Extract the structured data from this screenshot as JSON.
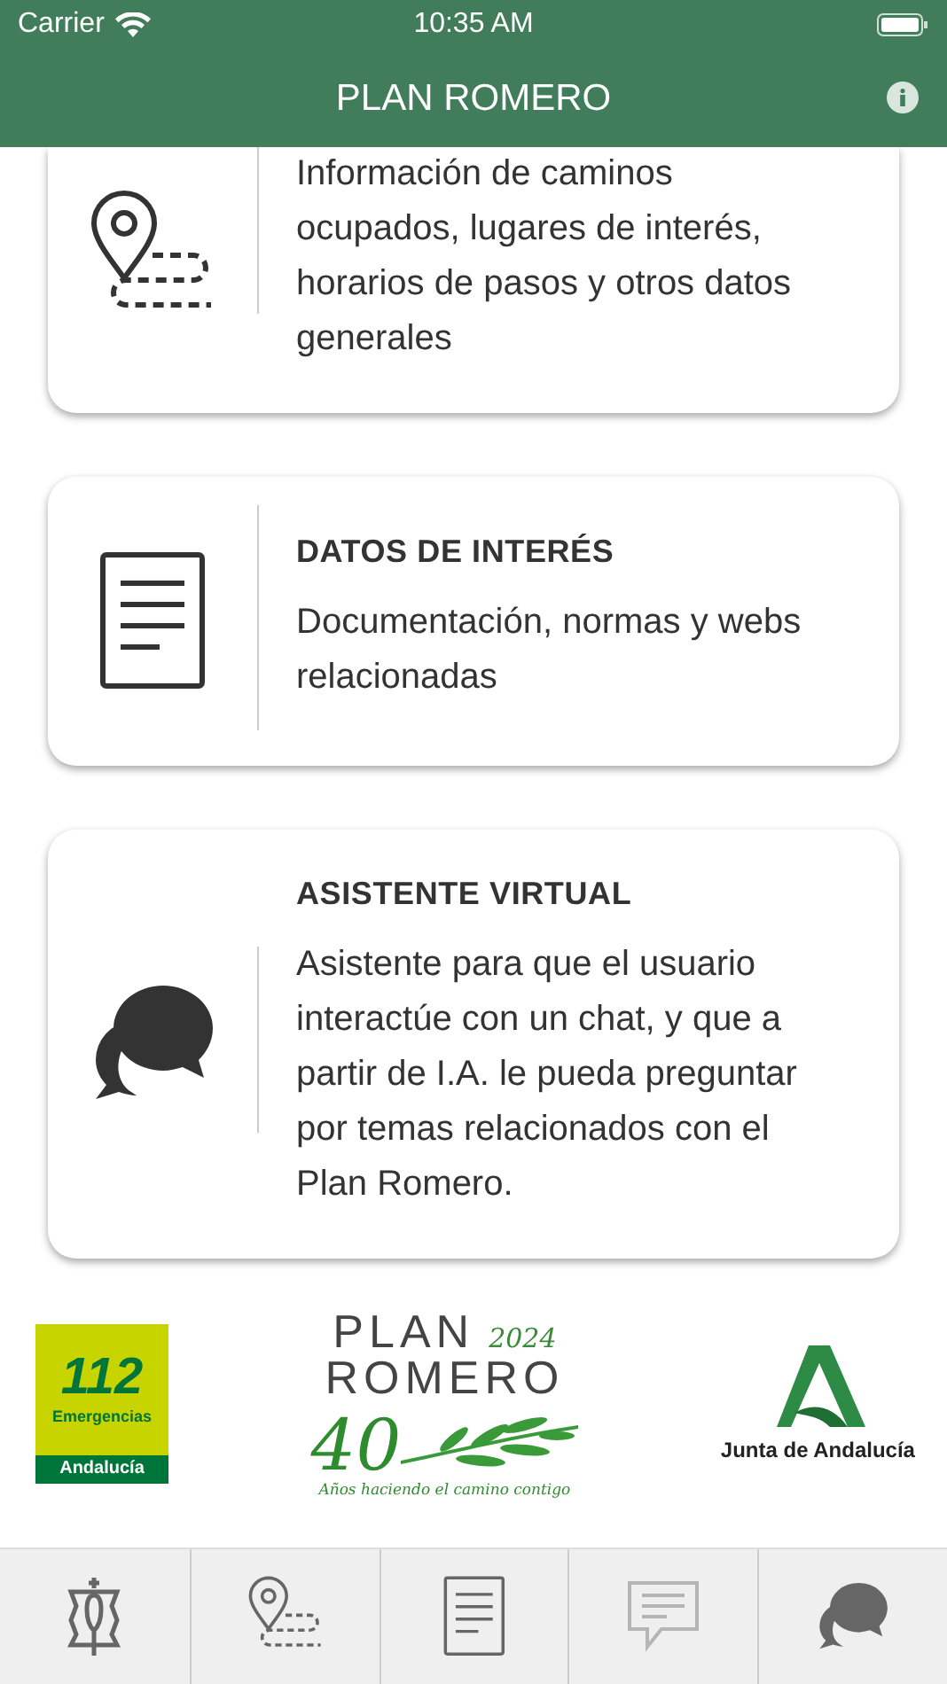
{
  "status_bar": {
    "carrier": "Carrier",
    "time": "10:35 AM"
  },
  "nav": {
    "title": "PLAN ROMERO"
  },
  "cards": [
    {
      "kind": "route",
      "description": "Información de caminos ocupados, lugares de interés, horarios de pasos y otros datos generales"
    },
    {
      "kind": "document",
      "title": "DATOS DE INTERÉS",
      "description": "Documentación, normas y webs relacionadas"
    },
    {
      "kind": "chat",
      "title": "ASISTENTE VIRTUAL",
      "description": "Asistente para que el usuario interactúe con un chat, y que a partir de I.A. le pueda preguntar por temas relacionados con el Plan Romero."
    }
  ],
  "logos": {
    "emergency": {
      "number": "112",
      "line": "Emergencias",
      "region": "Andalucía"
    },
    "plan": {
      "word_1": "PLAN",
      "year": "2024",
      "word_2": "ROMERO",
      "number": "40",
      "motto": "Años haciendo el camino contigo"
    },
    "junta": {
      "name": "Junta de Andalucía"
    }
  },
  "tabs": [
    {
      "kind": "banner",
      "disabled": false
    },
    {
      "kind": "route",
      "disabled": false
    },
    {
      "kind": "document",
      "disabled": false
    },
    {
      "kind": "message",
      "disabled": true
    },
    {
      "kind": "chat",
      "disabled": false
    }
  ]
}
